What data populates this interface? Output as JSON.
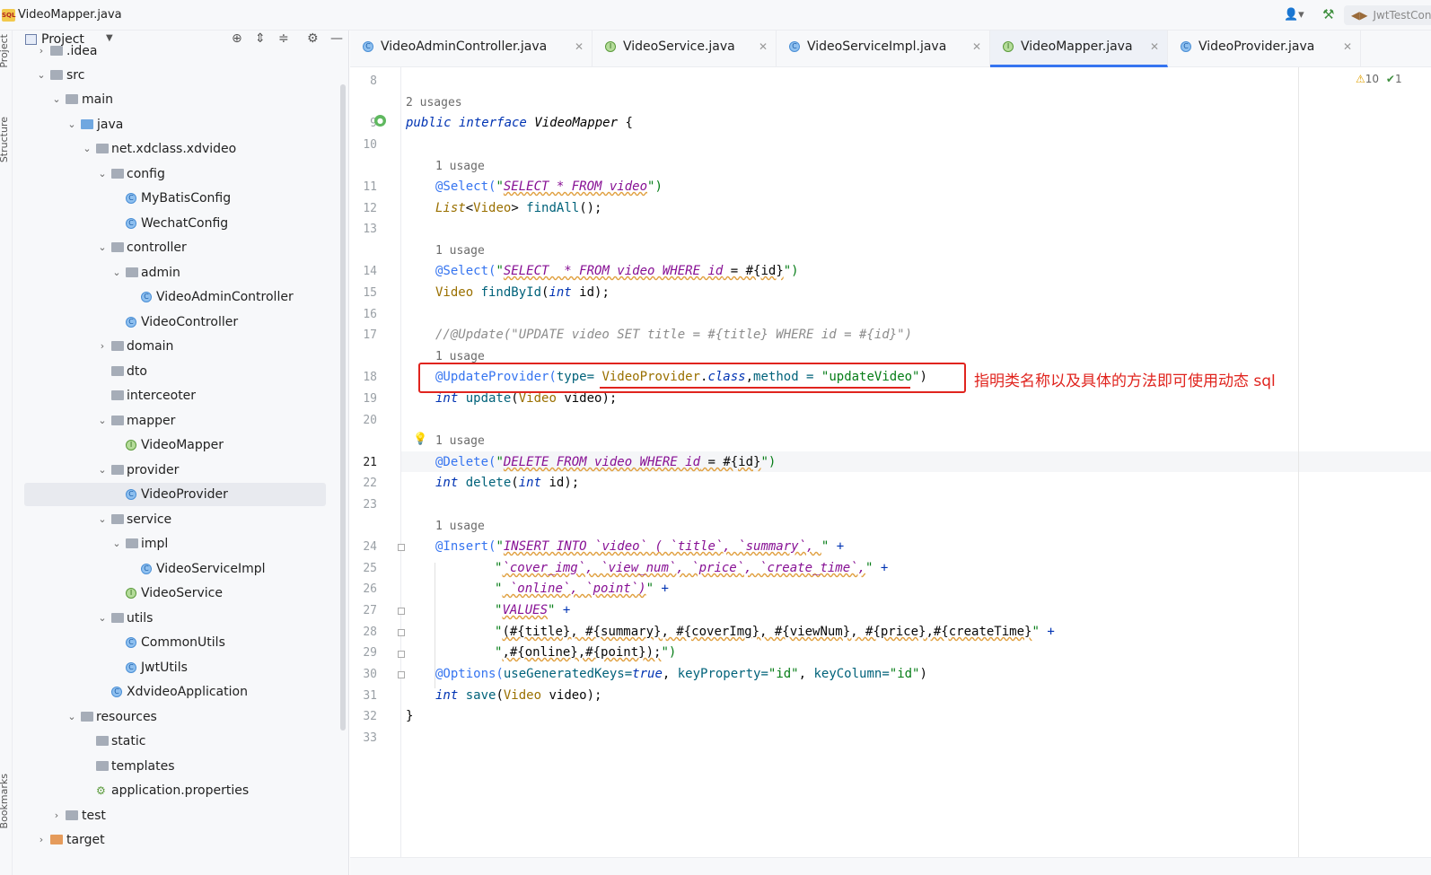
{
  "window": {
    "title": "VideoMapper.java",
    "run_config": "JwtTestCon"
  },
  "stripe": {
    "project_label": "Project",
    "structure_label": "Structure",
    "bookmarks_label": "Bookmarks"
  },
  "project_panel": {
    "title": "Project"
  },
  "tree": [
    {
      "label": ".idea"
    },
    {
      "label": "src"
    },
    {
      "label": "main"
    },
    {
      "label": "java"
    },
    {
      "label": "net.xdclass.xdvideo"
    },
    {
      "label": "config"
    },
    {
      "label": "MyBatisConfig"
    },
    {
      "label": "WechatConfig"
    },
    {
      "label": "controller"
    },
    {
      "label": "admin"
    },
    {
      "label": "VideoAdminController"
    },
    {
      "label": "VideoController"
    },
    {
      "label": "domain"
    },
    {
      "label": "dto"
    },
    {
      "label": "interceoter"
    },
    {
      "label": "mapper"
    },
    {
      "label": "VideoMapper"
    },
    {
      "label": "provider"
    },
    {
      "label": "VideoProvider"
    },
    {
      "label": "service"
    },
    {
      "label": "impl"
    },
    {
      "label": "VideoServiceImpl"
    },
    {
      "label": "VideoService"
    },
    {
      "label": "utils"
    },
    {
      "label": "CommonUtils"
    },
    {
      "label": "JwtUtils"
    },
    {
      "label": "XdvideoApplication"
    },
    {
      "label": "resources"
    },
    {
      "label": "static"
    },
    {
      "label": "templates"
    },
    {
      "label": "application.properties"
    },
    {
      "label": "test"
    },
    {
      "label": "target"
    }
  ],
  "tabs": [
    {
      "label": "VideoAdminController.java",
      "icon": "C"
    },
    {
      "label": "VideoService.java",
      "icon": "I"
    },
    {
      "label": "VideoServiceImpl.java",
      "icon": "C"
    },
    {
      "label": "VideoMapper.java",
      "icon": "I"
    },
    {
      "label": "VideoProvider.java",
      "icon": "C"
    }
  ],
  "inspection": {
    "warnings": "10",
    "ok": "1"
  },
  "line_numbers": [
    "8",
    "9",
    "10",
    "11",
    "12",
    "13",
    "14",
    "15",
    "16",
    "17",
    "18",
    "19",
    "20",
    "21",
    "22",
    "23",
    "24",
    "25",
    "26",
    "27",
    "28",
    "29",
    "30",
    "31",
    "32",
    "33"
  ],
  "usages": {
    "u9": "2 usages",
    "u11": "1 usage",
    "u14": "1 usage",
    "u18": "1 usage",
    "u21": "1 usage",
    "u24": "1 usage"
  },
  "code": {
    "l9_kw": "public interface ",
    "l9_name": "VideoMapper",
    "l9_rest": " {",
    "l11_ann": "@Select(",
    "l11_q1": "\"",
    "l11_sql": "SELECT * FROM video",
    "l11_q2": "\")",
    "l12_type": "List",
    "l12_lt": "<",
    "l12_gen": "Video",
    "l12_gt": "> ",
    "l12_meth": "findAll",
    "l12_rest": "();",
    "l14_ann": "@Select(",
    "l14_q1": "\"",
    "l14_sql": "SELECT  * FROM video WHERE id",
    "l14_rest": " = #{id}",
    "l14_q2": "\")",
    "l15_type": "Video ",
    "l15_meth": "findById",
    "l15_p": "(",
    "l15_kw": "int",
    "l15_rest": " id);",
    "l17": "//@Update(\"UPDATE video SET title = #{title} WHERE id = #{id}\")",
    "l18_ann": "@UpdateProvider(",
    "l18_attr1": "type= ",
    "l18_cls": "VideoProvider",
    "l18_dot": ".",
    "l18_kw": "class",
    "l18_comma": ",",
    "l18_attr2": "method = ",
    "l18_str": "\"updateVideo\"",
    "l18_end": ")",
    "l19_kw": "int ",
    "l19_meth": "update",
    "l19_p": "(",
    "l19_type": "Video",
    "l19_rest": " video);",
    "l21_ann": "@Delete(",
    "l21_q1": "\"",
    "l21_sql": "DELETE FROM video WHERE id",
    "l21_rest": " = #{id}",
    "l21_q2": "\")",
    "l22_kw": "int ",
    "l22_meth": "delete",
    "l22_p": "(",
    "l22_kw2": "int",
    "l22_rest": " id);",
    "l24_ann": "@Insert(",
    "l24_q1": "\"",
    "l24_sql": "INSERT INTO `video` ( `title`, `summary`, ",
    "l24_q2": "\" ",
    "l24_plus": "+",
    "l25_q1": "\"",
    "l25_sql": "`cover_img`, `view_num`, `price`, `create_time`,",
    "l25_q2": "\" ",
    "l25_plus": "+",
    "l26_q1": "\"",
    "l26_sql": " `online`, `point`)",
    "l26_q2": "\" ",
    "l26_plus": "+",
    "l27_q1": "\"",
    "l27_sql": "VALUES",
    "l27_q2": "\" ",
    "l27_plus": "+",
    "l28_q1": "\"",
    "l28_sql": "(#{title}, #{summary}, #{coverImg}, #{viewNum}, #{price},#{createTime}",
    "l28_q2": "\" ",
    "l28_plus": "+",
    "l29_q1": "\"",
    "l29_sql": ",#{online},#{point});",
    "l29_q2": "\")",
    "l30_ann": "@Options(",
    "l30_a1": "useGeneratedKeys=",
    "l30_true": "true",
    "l30_c1": ", ",
    "l30_a2": "keyProperty=",
    "l30_s1": "\"id\"",
    "l30_c2": ", ",
    "l30_a3": "keyColumn=",
    "l30_s2": "\"id\"",
    "l30_end": ")",
    "l31_kw": "int ",
    "l31_meth": "save",
    "l31_p": "(",
    "l31_type": "Video",
    "l31_rest": " video);",
    "l32": "}"
  },
  "annotation_note": "指明类名称以及具体的方法即可使用动态 sql",
  "colors": {
    "annotation_red": "#e0241e",
    "accent": "#3574f0"
  }
}
